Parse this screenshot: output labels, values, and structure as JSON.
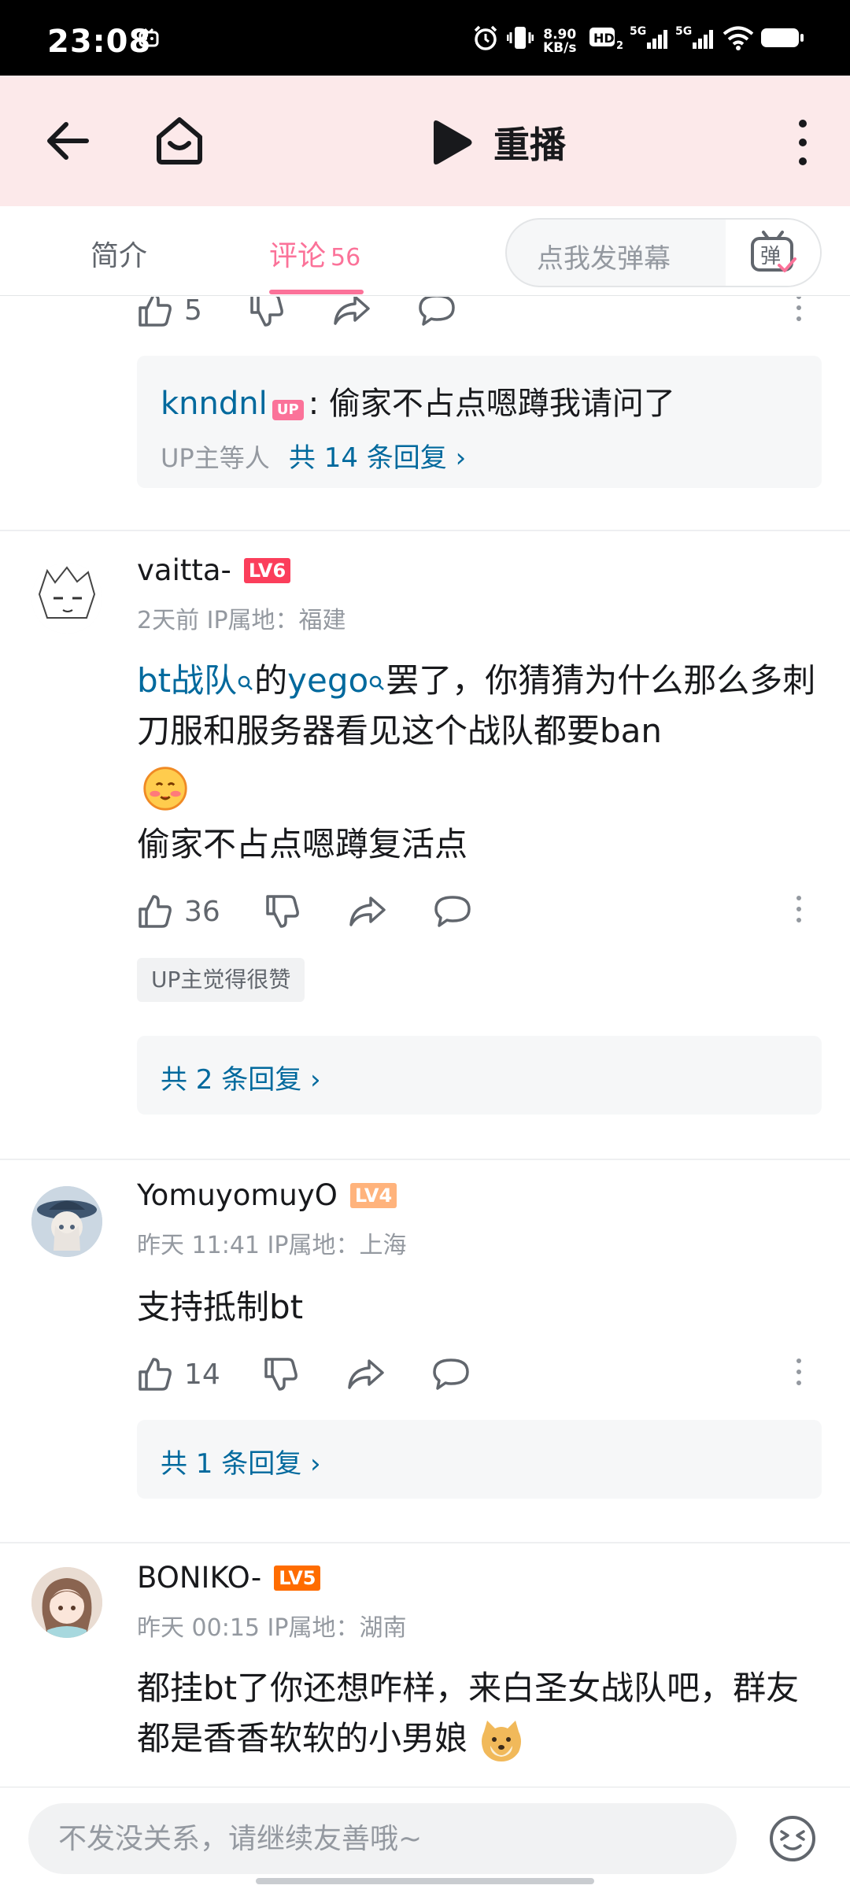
{
  "status_bar": {
    "time": "23:08",
    "net_speed_value": "8.90",
    "net_speed_unit": "KB/s",
    "icons": [
      "notification-tv-icon",
      "alarm-icon",
      "vibrate-icon",
      "hd-icon",
      "signal-5g-icon",
      "signal-5g-icon",
      "wifi-icon",
      "battery-icon"
    ]
  },
  "nav": {
    "title": "重播",
    "icons": [
      "back-icon",
      "home-icon",
      "play-icon",
      "more-icon"
    ]
  },
  "tabs": {
    "intro": "简介",
    "comments": "评论",
    "comments_count": "56",
    "danmaku_placeholder": "点我发弹幕",
    "danmaku_button": "弹"
  },
  "comments": {
    "prev": {
      "likes": "5",
      "reply_user": "knndnl",
      "reply_badge": "UP",
      "reply_text": ": 偷家不占点嗯蹲我请问了",
      "reply_meta": "UP主等人",
      "reply_link": "共 14 条回复 ›"
    },
    "c1": {
      "user": "vaitta-",
      "level": "LV6",
      "meta": "2天前 IP属地：福建",
      "link1": "bt战队",
      "mid1": "的",
      "link2": "yego",
      "text1": "罢了，你猜猜为什么那么多刺刀服和服务器看见这个战队都要ban",
      "text2": "偷家不占点嗯蹲复活点",
      "likes": "36",
      "up_liked": "UP主觉得很赞",
      "replies": "共 2 条回复 ›"
    },
    "c2": {
      "user": "YomuyomuyO",
      "level": "LV4",
      "meta": "昨天 11:41 IP属地：上海",
      "text": "支持抵制bt",
      "likes": "14",
      "replies": "共 1 条回复 ›"
    },
    "c3": {
      "user": "BONIKO-",
      "level": "LV5",
      "meta": "昨天 00:15 IP属地：湖南",
      "text": "都挂bt了你还想咋样，来白圣女战队吧，群友都是香香软软的小男娘"
    }
  },
  "colors": {
    "accent": "#fb7299",
    "link": "#00699d",
    "lv6": "#fb3e5b",
    "lv5": "#ff6c00",
    "lv4": "#ffb37c",
    "header_bg": "#fce9ea"
  },
  "bottom": {
    "placeholder": "不发没关系，请继续友善哦~",
    "emoji_icon": "emoji-icon"
  }
}
